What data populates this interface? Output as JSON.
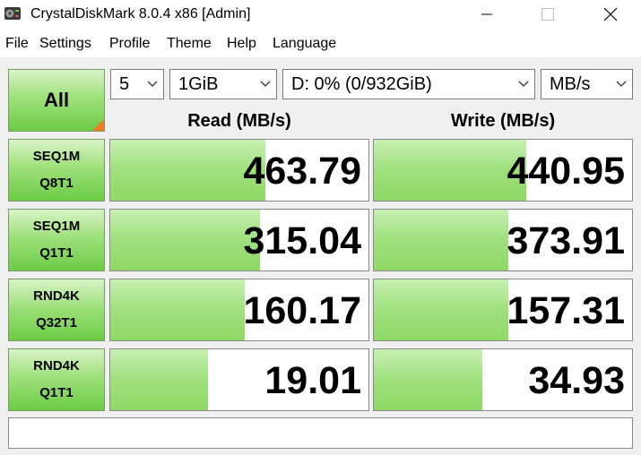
{
  "window": {
    "title": "CrystalDiskMark 8.0.4 x86 [Admin]",
    "icon": "crystaldiskmark-icon",
    "controls": [
      "minimize-icon",
      "maximize-icon",
      "close-icon"
    ]
  },
  "menu": [
    "File",
    "Settings",
    "Profile",
    "Theme",
    "Help",
    "Language"
  ],
  "toolbar": {
    "all_label": "All",
    "count": "5",
    "size": "1GiB",
    "drive": "D: 0% (0/932GiB)",
    "unit": "MB/s"
  },
  "columns": {
    "read": "Read (MB/s)",
    "write": "Write (MB/s)"
  },
  "colors": {
    "accent_green": "#6ccc45",
    "bar_green": "#9fe07c",
    "corner_orange": "#ef7d25"
  },
  "tests": [
    {
      "line1": "SEQ1M",
      "line2": "Q8T1",
      "read": "463.79",
      "write": "440.95",
      "read_fill": 0.6,
      "write_fill": 0.59
    },
    {
      "line1": "SEQ1M",
      "line2": "Q1T1",
      "read": "315.04",
      "write": "373.91",
      "read_fill": 0.58,
      "write_fill": 0.52
    },
    {
      "line1": "RND4K",
      "line2": "Q32T1",
      "read": "160.17",
      "write": "157.31",
      "read_fill": 0.52,
      "write_fill": 0.52
    },
    {
      "line1": "RND4K",
      "line2": "Q1T1",
      "read": "19.01",
      "write": "34.93",
      "read_fill": 0.38,
      "write_fill": 0.42
    }
  ],
  "comment": ""
}
